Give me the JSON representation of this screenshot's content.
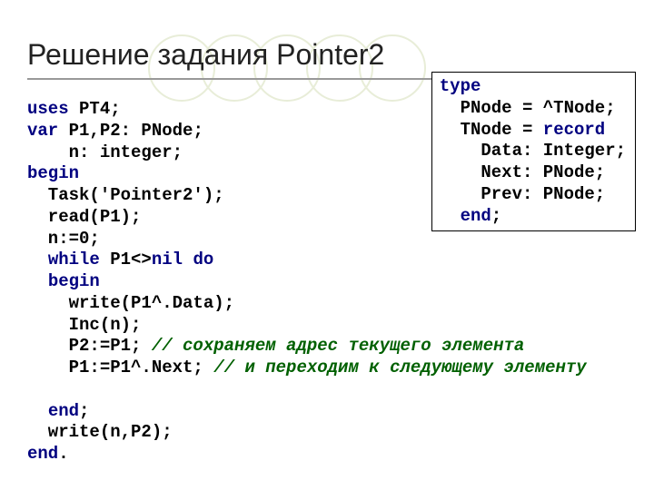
{
  "title": "Решение задания Pointer2",
  "code": {
    "l1": {
      "kw": "uses",
      "rest": " PT4;"
    },
    "l2": {
      "kw": "var",
      "rest": " P1,P2: PNode;"
    },
    "l3": "    n: integer;",
    "l4": {
      "kw": "begin"
    },
    "l5": "  Task('Pointer2');",
    "l6": "  read(P1);",
    "l7": "  n:=0;",
    "l8a": "  ",
    "l8kw1": "while",
    "l8b": " P1<>",
    "l8kw2": "nil",
    "l8c": " ",
    "l8kw3": "do",
    "l9": {
      "pad": "  ",
      "kw": "begin"
    },
    "l10": "    write(P1^.Data);",
    "l11": "    Inc(n);",
    "l12": {
      "code": "    P2:=P1; ",
      "cmt": "// сохраняем адрес текущего элемента"
    },
    "l13": {
      "code": "    P1:=P1^.Next; ",
      "cmt": "// и переходим к следующему элементу"
    },
    "blank": " ",
    "l14": {
      "pad": "  ",
      "kw": "end",
      "rest": ";"
    },
    "l15": "  write(n,P2);",
    "l16": {
      "kw": "end",
      "rest": "."
    }
  },
  "typebox": {
    "t1": {
      "kw": "type"
    },
    "t2": "  PNode = ^TNode;",
    "t3a": "  TNode = ",
    "t3kw": "record",
    "t4": "    Data: Integer;",
    "t5": "    Next: PNode;",
    "t6": "    Prev: PNode;",
    "t7": {
      "pad": "  ",
      "kw": "end",
      "rest": ";"
    }
  }
}
